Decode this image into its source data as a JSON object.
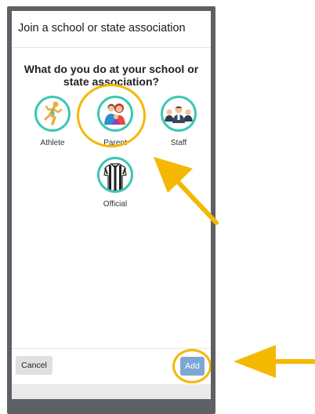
{
  "dialog": {
    "title": "Join a school or state association",
    "question": "What do you do at your school or state association?"
  },
  "roles": [
    {
      "label": "Athlete",
      "icon": "athlete-icon",
      "selected": false
    },
    {
      "label": "Parent",
      "icon": "parent-icon",
      "selected": true
    },
    {
      "label": "Staff",
      "icon": "staff-icon",
      "selected": false
    },
    {
      "label": "Official",
      "icon": "official-icon",
      "selected": false
    }
  ],
  "footer": {
    "cancel_label": "Cancel",
    "add_label": "Add"
  },
  "colors": {
    "accent_teal": "#3cc7b6",
    "highlight_yellow": "#f5b800",
    "add_button": "#7fa7d6",
    "frame": "#5d6064"
  }
}
